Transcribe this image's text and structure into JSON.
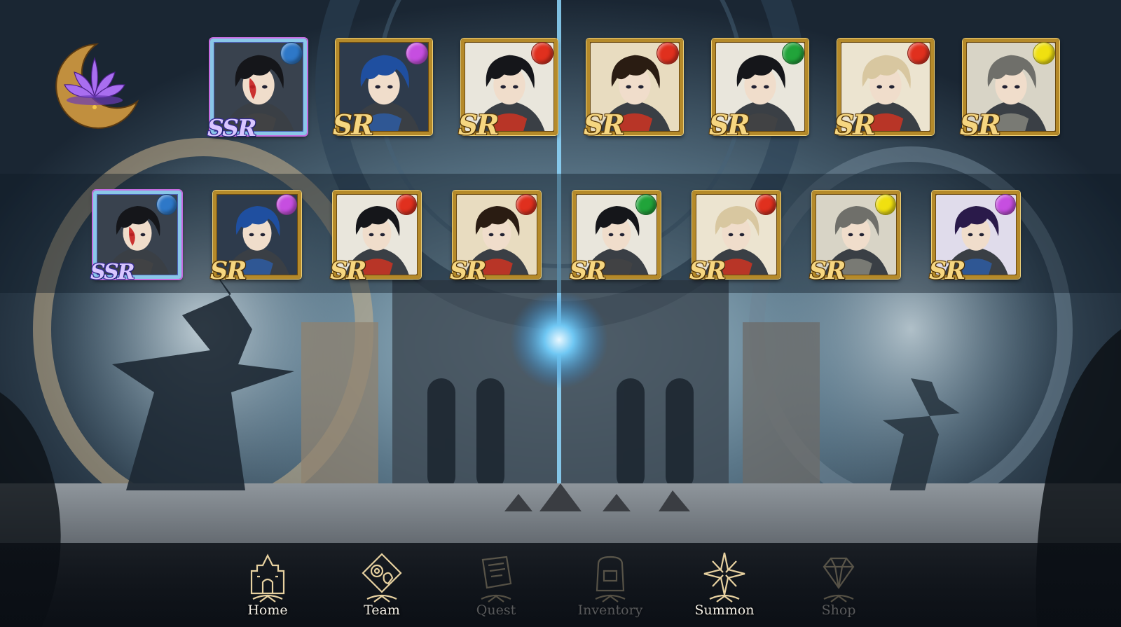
{
  "colors": {
    "sr_gold": "#b58a2a",
    "ssr_frame": "#8ac7e8",
    "orb_blue": "#2e78c8",
    "orb_purple": "#c64ee0",
    "orb_red": "#e0301e",
    "orb_green": "#21a43a",
    "orb_yellow": "#f0e010",
    "nav_text": "#f3efe6"
  },
  "emblem": {
    "icon": "lotus-crescent-moon-icon"
  },
  "formation": {
    "cards": [
      {
        "rarity": "SSR",
        "element": "blue",
        "hair": "black"
      },
      {
        "rarity": "SR",
        "element": "purple",
        "hair": "blue"
      },
      {
        "rarity": "SR",
        "element": "red",
        "hair": "black"
      },
      {
        "rarity": "SR",
        "element": "red",
        "hair": "dark-orange"
      },
      {
        "rarity": "SR",
        "element": "green",
        "hair": "black"
      },
      {
        "rarity": "SR",
        "element": "red",
        "hair": "blonde"
      },
      {
        "rarity": "SR",
        "element": "yellow",
        "hair": "gray"
      }
    ]
  },
  "roster": {
    "cards": [
      {
        "rarity": "SSR",
        "element": "blue",
        "hair": "black"
      },
      {
        "rarity": "SR",
        "element": "purple",
        "hair": "blue"
      },
      {
        "rarity": "SR",
        "element": "red",
        "hair": "black"
      },
      {
        "rarity": "SR",
        "element": "red",
        "hair": "dark-orange"
      },
      {
        "rarity": "SR",
        "element": "green",
        "hair": "black"
      },
      {
        "rarity": "SR",
        "element": "red",
        "hair": "blonde"
      },
      {
        "rarity": "SR",
        "element": "yellow",
        "hair": "gray"
      },
      {
        "rarity": "SR",
        "element": "purple",
        "hair": "dark-purple"
      }
    ]
  },
  "nav": {
    "items": [
      {
        "label": "Home",
        "icon": "castle-icon",
        "enabled": true
      },
      {
        "label": "Team",
        "icon": "team-gear-icon",
        "enabled": true
      },
      {
        "label": "Quest",
        "icon": "scroll-icon",
        "enabled": false
      },
      {
        "label": "Inventory",
        "icon": "backpack-icon",
        "enabled": false
      },
      {
        "label": "Summon",
        "icon": "compass-star-icon",
        "enabled": true
      },
      {
        "label": "Shop",
        "icon": "gem-icon",
        "enabled": false
      }
    ]
  }
}
